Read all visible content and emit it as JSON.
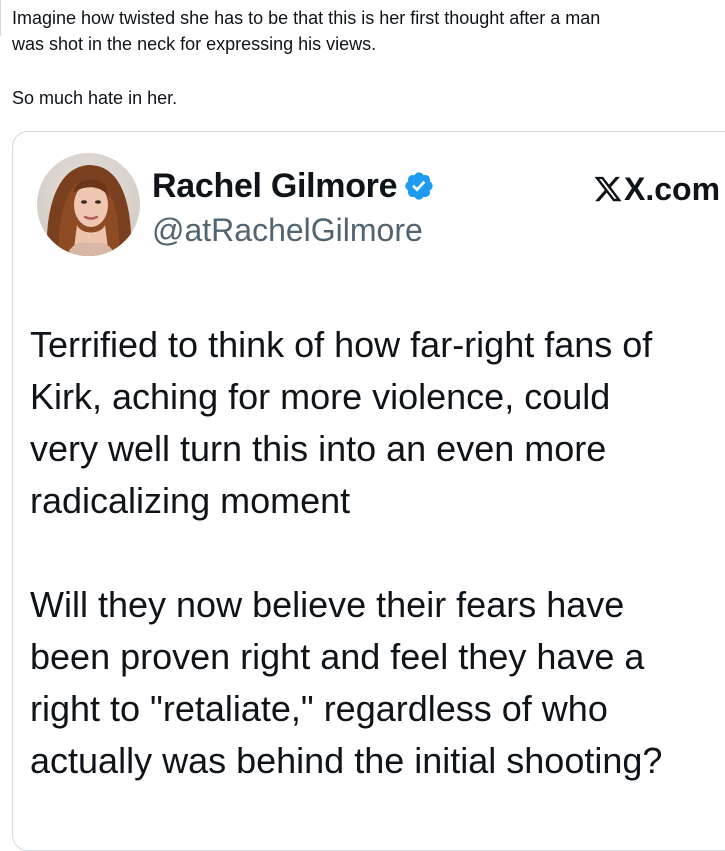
{
  "post": {
    "lines": [
      "Imagine how twisted she has to be that this is her first thought after a man",
      "was shot in the neck for expressing his views."
    ],
    "closing": "So much hate in her."
  },
  "quoted_tweet": {
    "author_name": "Rachel Gilmore",
    "author_handle": "@atRachelGilmore",
    "verified_icon": "verified-badge-icon",
    "source_site": "X.com",
    "paragraph1": [
      "Terrified to think of how far-right fans of",
      "Kirk, aching for more violence, could",
      "very well turn this into an even more",
      "radicalizing moment"
    ],
    "paragraph2": [
      "Will they now believe their fears have",
      "been proven right and feel they have a",
      "right to \"retaliate,\" regardless of who",
      "actually was behind the initial shooting?"
    ]
  },
  "colors": {
    "text": "#0f1419",
    "secondary_text": "#536471",
    "verified_blue": "#1d9bf0",
    "border": "#cfd9de"
  }
}
